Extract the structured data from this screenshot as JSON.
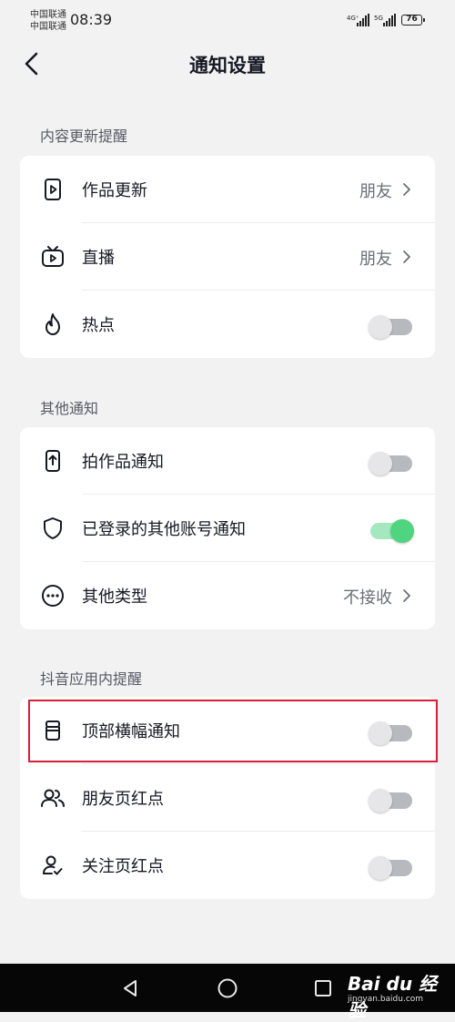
{
  "status_bar": {
    "carrier_1": "中国联通",
    "carrier_2": "中国联通",
    "time": "08:39",
    "network_1": "4G⁺",
    "network_2": "5G",
    "battery": "76"
  },
  "header": {
    "title": "通知设置",
    "back_icon": "chevron-left-icon"
  },
  "sections": [
    {
      "title": "内容更新提醒",
      "rows": [
        {
          "label": "作品更新",
          "icon": "video-play-icon",
          "value": "朋友",
          "type": "link"
        },
        {
          "label": "直播",
          "icon": "tv-live-icon",
          "value": "朋友",
          "type": "link"
        },
        {
          "label": "热点",
          "icon": "flame-icon",
          "type": "toggle",
          "on": false
        }
      ]
    },
    {
      "title": "其他通知",
      "rows": [
        {
          "label": "拍作品通知",
          "icon": "phone-upload-icon",
          "type": "toggle",
          "on": false
        },
        {
          "label": "已登录的其他账号通知",
          "icon": "shield-icon",
          "type": "toggle",
          "on": true
        },
        {
          "label": "其他类型",
          "icon": "more-circle-icon",
          "value": "不接收",
          "type": "link"
        }
      ]
    },
    {
      "title": "抖音应用内提醒",
      "rows": [
        {
          "label": "顶部横幅通知",
          "icon": "banner-icon",
          "type": "toggle",
          "on": false
        },
        {
          "label": "朋友页红点",
          "icon": "users-icon",
          "type": "toggle",
          "on": false
        },
        {
          "label": "关注页红点",
          "icon": "user-check-icon",
          "type": "toggle",
          "on": false
        }
      ]
    }
  ],
  "colors": {
    "toggle_on": "#4fd47f",
    "toggle_off": "#b8b9be",
    "highlight": "#d6213b"
  },
  "system_nav": {
    "back": "triangle-back-icon",
    "home": "circle-home-icon",
    "recents": "square-recents-icon"
  },
  "watermark": {
    "brand": "Bai du 经验",
    "site": "jingyan.baidu.com"
  }
}
